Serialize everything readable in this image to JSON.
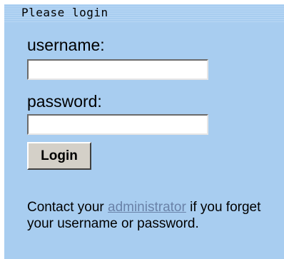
{
  "panel": {
    "title": "Please login"
  },
  "form": {
    "username_label": "username:",
    "username_value": "",
    "password_label": "password:",
    "password_value": "",
    "login_button": "Login"
  },
  "help": {
    "prefix": "Contact your ",
    "link_text": "administrator",
    "suffix": " if you forget your username or password."
  },
  "colors": {
    "background": "#a8cdf0",
    "link": "#6a82a8",
    "button_face": "#d4d0c8"
  }
}
